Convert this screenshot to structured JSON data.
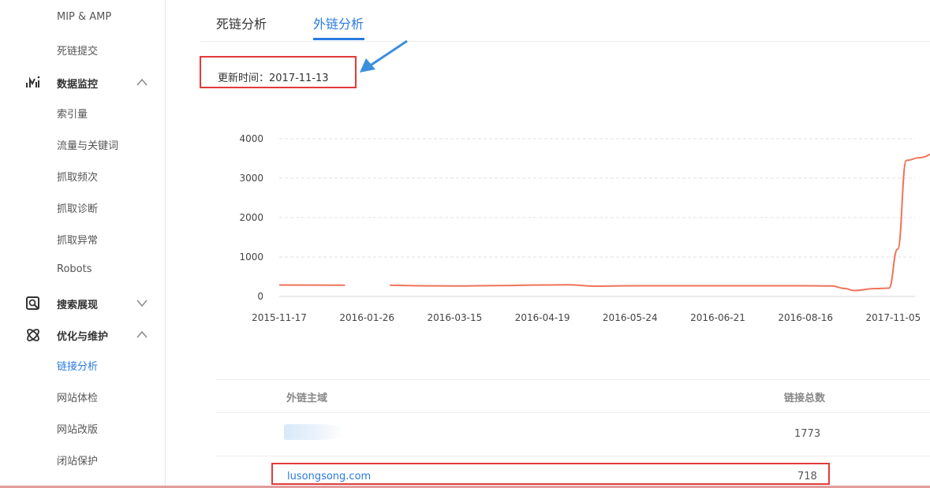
{
  "sidebar": {
    "items_top": [
      {
        "label": "MIP & AMP"
      },
      {
        "label": "死链提交"
      }
    ],
    "sections": [
      {
        "label": "数据监控",
        "icon": "chart-monitor-icon",
        "expanded": true,
        "items": [
          "索引量",
          "流量与关键词",
          "抓取频次",
          "抓取诊断",
          "抓取异常",
          "Robots"
        ]
      },
      {
        "label": "搜索展现",
        "icon": "search-display-icon",
        "expanded": false,
        "items": []
      },
      {
        "label": "优化与维护",
        "icon": "atom-optimize-icon",
        "expanded": true,
        "items": [
          "链接分析",
          "网站体检",
          "网站改版",
          "闭站保护"
        ],
        "active": "链接分析"
      }
    ]
  },
  "tabs": [
    {
      "label": "死链分析",
      "active": false
    },
    {
      "label": "外链分析",
      "active": true
    }
  ],
  "update": {
    "text": "更新时间：2017-11-13"
  },
  "colors": {
    "accent": "#2a7ae2",
    "line": "#f0735a",
    "highlight": "#e23a3a"
  },
  "chart_data": {
    "type": "line",
    "x_tick_labels": [
      "2015-11-17",
      "2016-01-26",
      "2016-03-15",
      "2016-04-19",
      "2016-05-24",
      "2016-06-21",
      "2016-08-16",
      "2017-11-05"
    ],
    "y_ticks": [
      0,
      1000,
      2000,
      3000,
      4000
    ],
    "ylim": [
      0,
      4000
    ],
    "grid": "horizontal-dashed",
    "series": [
      {
        "segments": [
          [
            [
              0.0,
              290
            ],
            [
              0.75,
              285
            ]
          ],
          [
            [
              1.26,
              285
            ],
            [
              1.6,
              270
            ],
            [
              2.0,
              265
            ],
            [
              2.5,
              275
            ],
            [
              3.0,
              290
            ],
            [
              3.3,
              295
            ],
            [
              3.6,
              260
            ],
            [
              4.0,
              270
            ],
            [
              4.5,
              270
            ],
            [
              5.0,
              270
            ],
            [
              5.5,
              270
            ],
            [
              6.0,
              270
            ],
            [
              6.3,
              265
            ],
            [
              6.45,
              200
            ],
            [
              6.55,
              150
            ],
            [
              6.8,
              200
            ],
            [
              6.95,
              210
            ],
            [
              7.05,
              1200
            ],
            [
              7.15,
              3450
            ],
            [
              7.3,
              3520
            ],
            [
              7.5,
              3650
            ],
            [
              7.6,
              3680
            ]
          ]
        ]
      }
    ]
  },
  "table": {
    "headers": {
      "domain": "外链主域",
      "total": "链接总数"
    },
    "rows": [
      {
        "domain": "",
        "total": "1773"
      },
      {
        "domain": "lusongsong.com",
        "total": "718"
      }
    ]
  }
}
